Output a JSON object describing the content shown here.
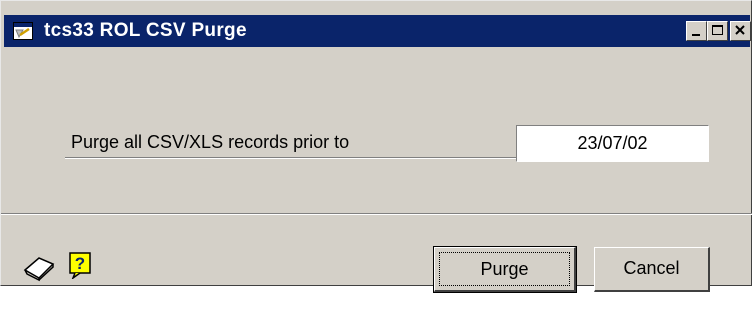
{
  "window": {
    "title": "tcs33 ROL CSV Purge",
    "controls": [
      "minimize",
      "maximize",
      "close"
    ]
  },
  "form": {
    "prompt_label": "Purge all CSV/XLS records prior to",
    "date_value": "23/07/02"
  },
  "toolbar": {
    "icons": [
      "note-icon",
      "help-icon"
    ]
  },
  "buttons": {
    "purge_label": "Purge",
    "cancel_label": "Cancel"
  },
  "colors": {
    "titlebar": "#0a246a",
    "window_face": "#d4d0c8",
    "help_icon_bg": "#ffff00"
  }
}
